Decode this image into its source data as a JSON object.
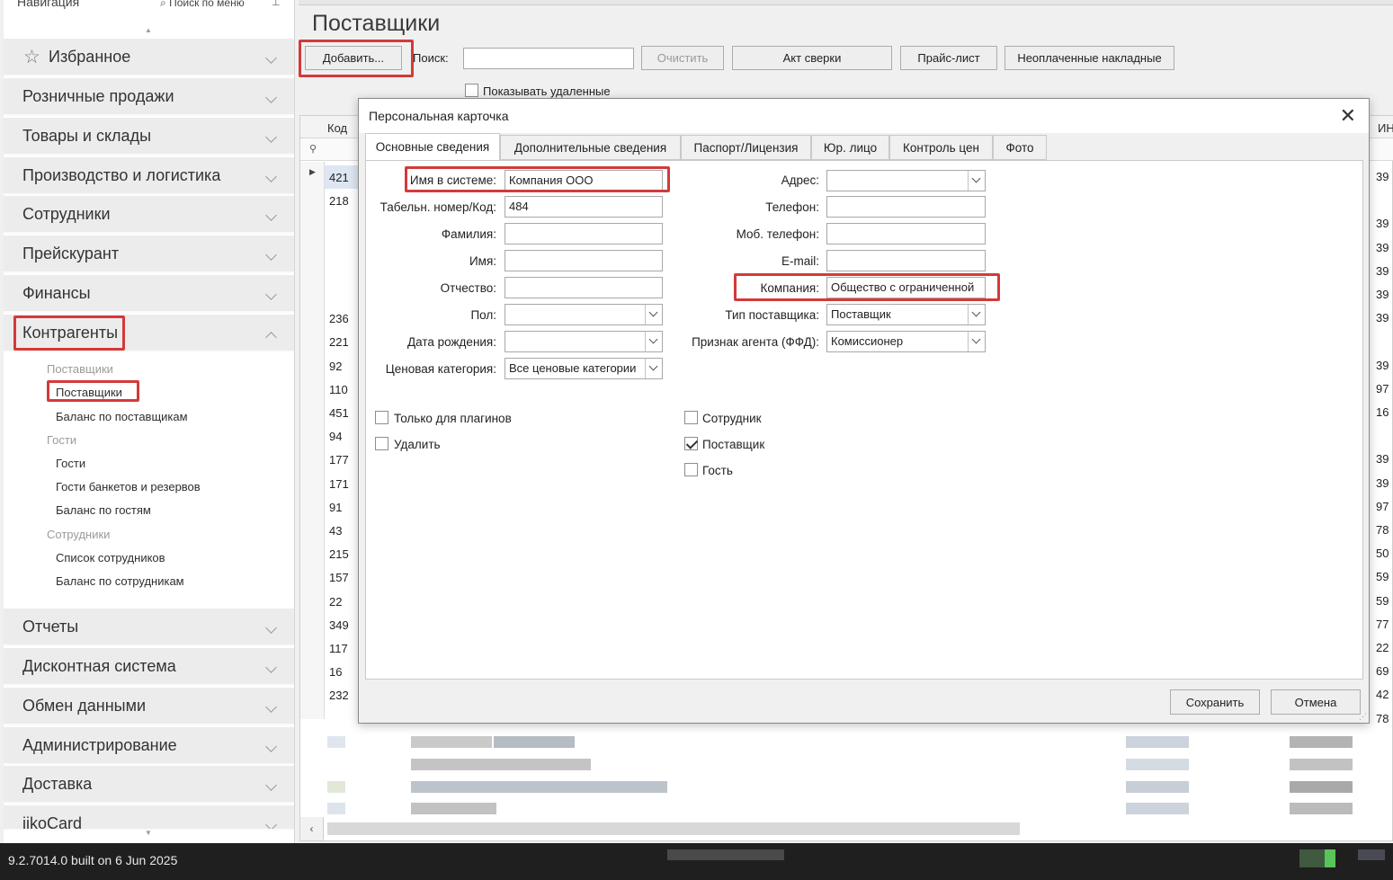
{
  "nav": {
    "title": "Навигация",
    "search": "Поиск по меню",
    "sections": [
      {
        "label": "Избранное"
      },
      {
        "label": "Розничные продажи"
      },
      {
        "label": "Товары и склады"
      },
      {
        "label": "Производство и логистика"
      },
      {
        "label": "Сотрудники"
      },
      {
        "label": "Прейскурант"
      },
      {
        "label": "Финансы"
      },
      {
        "label": "Контрагенты"
      }
    ],
    "contractors": [
      {
        "label": "Поставщики",
        "kind": "group"
      },
      {
        "label": "Поставщики",
        "kind": "item"
      },
      {
        "label": "Баланс по поставщикам",
        "kind": "item"
      },
      {
        "label": "Гости",
        "kind": "group"
      },
      {
        "label": "Гости",
        "kind": "item"
      },
      {
        "label": "Гости банкетов и резервов",
        "kind": "item"
      },
      {
        "label": "Баланс по гостям",
        "kind": "item"
      },
      {
        "label": "Сотрудники",
        "kind": "group"
      },
      {
        "label": "Список сотрудников",
        "kind": "item"
      },
      {
        "label": "Баланс по сотрудникам",
        "kind": "item"
      }
    ],
    "sections_bottom": [
      {
        "label": "Отчеты"
      },
      {
        "label": "Дисконтная система"
      },
      {
        "label": "Обмен данными"
      },
      {
        "label": "Администрирование"
      },
      {
        "label": "Доставка"
      },
      {
        "label": "iikoCard"
      }
    ]
  },
  "main": {
    "title": "Поставщики",
    "add_button": "Добавить...",
    "search_label": "Поиск:",
    "search_value": "",
    "clear_button": "Очистить",
    "reconcile_button": "Акт сверки",
    "pricelist_button": "Прайс-лист",
    "unpaid_button": "Неоплаченные накладные",
    "show_deleted": "Показывать удаленные",
    "grid": {
      "col_code": "Код",
      "col_right": "ИН",
      "codes": [
        "421",
        "218",
        "",
        "",
        "",
        "",
        "236",
        "221",
        "92",
        "110",
        "451",
        "94",
        "177",
        "171",
        "91",
        "43",
        "215",
        "157",
        "22",
        "349",
        "117",
        "16",
        "232"
      ],
      "right_values": [
        "39",
        "",
        "39",
        "39",
        "39",
        "39",
        "39",
        "",
        "39",
        "97",
        "16",
        "",
        "39",
        "39",
        "97",
        "78",
        "50",
        "59",
        "59",
        "77",
        "22",
        "69",
        "42",
        "78"
      ]
    }
  },
  "dialog": {
    "title": "Персональная карточка",
    "tabs": [
      {
        "label": "Основные сведения"
      },
      {
        "label": "Дополнительные сведения"
      },
      {
        "label": "Паспорт/Лицензия"
      },
      {
        "label": "Юр. лицо"
      },
      {
        "label": "Контроль цен"
      },
      {
        "label": "Фото"
      }
    ],
    "left_fields": {
      "system_name": {
        "label": "Имя в системе:",
        "value": "Компания ООО"
      },
      "tab_number": {
        "label": "Табельн. номер/Код:",
        "value": "484"
      },
      "last_name": {
        "label": "Фамилия:",
        "value": ""
      },
      "first_name": {
        "label": "Имя:",
        "value": ""
      },
      "patronymic": {
        "label": "Отчество:",
        "value": ""
      },
      "gender": {
        "label": "Пол:",
        "value": ""
      },
      "birth_date": {
        "label": "Дата рождения:",
        "value": ""
      },
      "price_category": {
        "label": "Ценовая категория:",
        "value": "Все ценовые категории"
      }
    },
    "right_fields": {
      "address": {
        "label": "Адрес:",
        "value": ""
      },
      "phone": {
        "label": "Телефон:",
        "value": ""
      },
      "mobile": {
        "label": "Моб. телефон:",
        "value": ""
      },
      "email": {
        "label": "E-mail:",
        "value": ""
      },
      "company": {
        "label": "Компания:",
        "value": "Общество с ограниченной"
      },
      "supplier_type": {
        "label": "Тип поставщика:",
        "value": "Поставщик"
      },
      "agent_sign": {
        "label": "Признак агента (ФФД):",
        "value": "Комиссионер"
      }
    },
    "checkboxes": {
      "plugins_only": {
        "label": "Только для плагинов",
        "checked": false
      },
      "delete": {
        "label": "Удалить",
        "checked": false
      },
      "employee": {
        "label": "Сотрудник",
        "checked": false
      },
      "supplier": {
        "label": "Поставщик",
        "checked": true
      },
      "guest": {
        "label": "Гость",
        "checked": false
      }
    },
    "save_button": "Сохранить",
    "cancel_button": "Отмена"
  },
  "status": {
    "version": "9.2.7014.0 built on 6 Jun 2025"
  },
  "colors": {
    "highlight": "#d33a3a"
  }
}
